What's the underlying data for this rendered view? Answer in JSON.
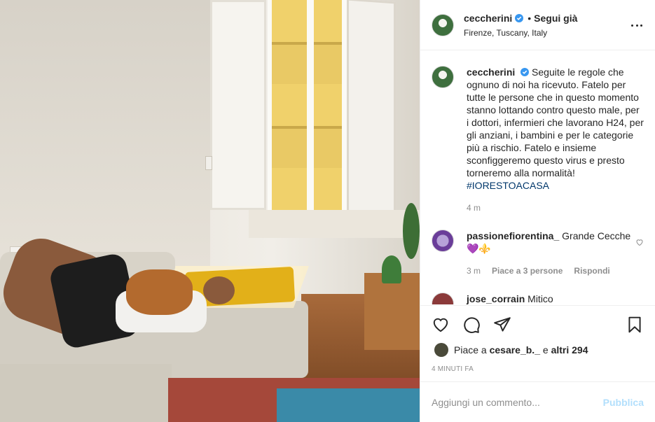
{
  "post": {
    "image_alt": "",
    "author": {
      "username": "ceccherini",
      "follow_status": "Segui già",
      "location": "Firenze, Tuscany, Italy"
    },
    "caption": {
      "username": "ceccherini",
      "text": "Seguite le regole che ognuno di noi ha ricevuto. Fatelo per tutte le persone che in questo momento stanno lottando contro questo male, per i dottori, infermieri che lavorano H24, per gli anziani, i bambini e per le categorie più a rischio. Fatelo e insieme sconfiggeremo questo virus e presto torneremo alla normalità!",
      "hashtag": "#IORESTOACASA",
      "time": "4 m"
    },
    "comments": [
      {
        "username": "passionefiorentina_",
        "text": "Grande Cecche 💜⚜️",
        "time": "3 m",
        "likes": "Piace a 3 persone",
        "reply": "Rispondi"
      },
      {
        "username": "jose_corrain",
        "text": "Mitico"
      }
    ],
    "likes": {
      "prefix": "Piace a",
      "user": "cesare_b._",
      "conj": "e",
      "others": "altri 294"
    },
    "timestamp": "4 minuti fa",
    "add_comment": {
      "placeholder": "Aggiungi un commento...",
      "publish_label": "Pubblica"
    }
  },
  "colors": {
    "verified": "#3897f0",
    "link": "#00376b",
    "muted": "#8e8e8e",
    "publish_disabled": "#b2dffc"
  },
  "icons": [
    "verified-icon",
    "more-options-icon",
    "heart-icon",
    "comment-icon",
    "share-icon",
    "bookmark-icon",
    "heart-small-icon"
  ]
}
